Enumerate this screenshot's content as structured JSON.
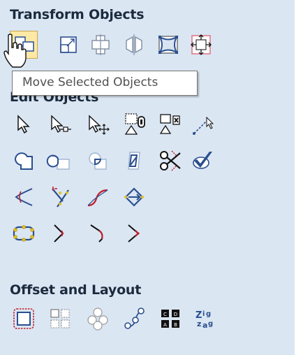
{
  "sections": {
    "transform": {
      "title": "Transform Objects"
    },
    "edit": {
      "title": "Edit Objects"
    },
    "offset": {
      "title": "Offset and Layout"
    }
  },
  "tooltip": {
    "text": "Move Selected Objects"
  },
  "tools": {
    "transform": [
      "move-icon",
      "scale-icon",
      "align-icon",
      "mirror-icon",
      "distort-icon",
      "set-position-icon"
    ],
    "edit_row1": [
      "select-icon",
      "node-edit-icon",
      "interactive-transform-icon",
      "group-icon",
      "ungroup-icon",
      "measure-icon"
    ],
    "edit_row2": [
      "weld-icon",
      "subtract-icon",
      "intersect-icon",
      "trim-icon",
      "scissors-icon",
      "validate-icon"
    ],
    "edit_row3": [
      "fillet-icon",
      "corner-icon",
      "curve-fit-icon",
      "join-icon"
    ],
    "edit_row4": [
      "close-vector-icon",
      "extend-icon",
      "curve-edit-icon",
      "smooth-node-icon"
    ],
    "offset": [
      "offset-icon",
      "array-copy-icon",
      "circular-array-icon",
      "copy-along-icon",
      "nest-icon",
      "text-fit-icon"
    ]
  },
  "colors": {
    "panel_bg": "#dbe6f3",
    "icon_blue": "#2a4f8f",
    "accent_red": "#c0202a",
    "highlight": "#fde9a6"
  }
}
